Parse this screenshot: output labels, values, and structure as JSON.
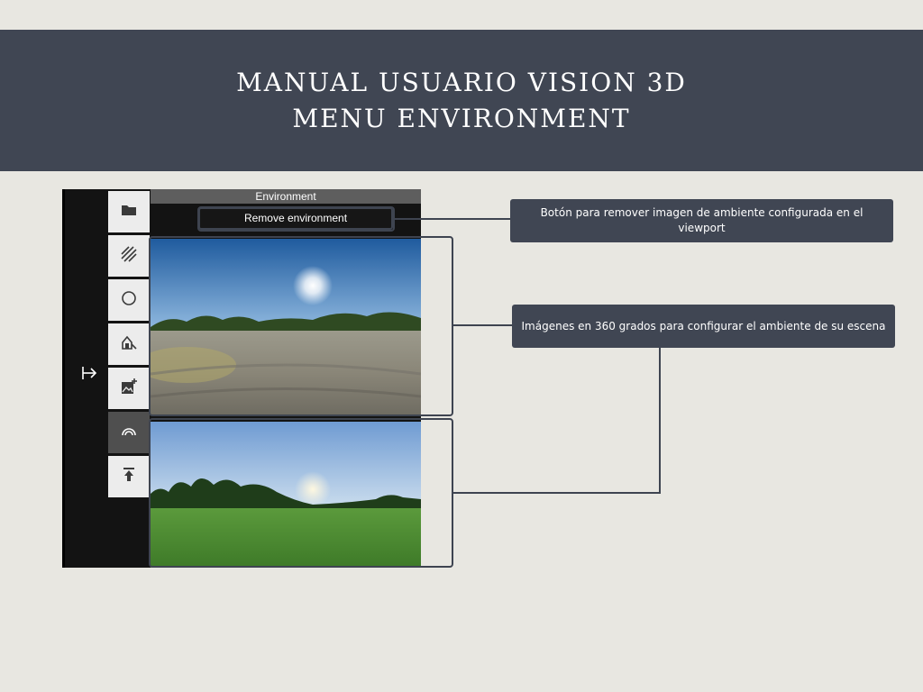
{
  "header": {
    "title_line1": "MANUAL USUARIO VISION 3D",
    "title_line2": "MENU ENVIRONMENT"
  },
  "app": {
    "panel_title": "Environment",
    "remove_button_label": "Remove environment",
    "toolbar": [
      {
        "icon": "folder-icon",
        "active": false
      },
      {
        "icon": "hatch-pattern-icon",
        "active": false
      },
      {
        "icon": "circle-icon",
        "active": false
      },
      {
        "icon": "house-light-icon",
        "active": false
      },
      {
        "icon": "add-image-icon",
        "active": false
      },
      {
        "icon": "environment-dome-icon",
        "active": true
      },
      {
        "icon": "upload-icon",
        "active": false
      }
    ],
    "collapse_icon": "arrow-right-bar-icon",
    "environments": [
      {
        "name": "gravel-field-sunny",
        "sky": "#2f6fb3",
        "ground": "#8a877d"
      },
      {
        "name": "green-meadow-forest",
        "sky": "#7aa3d6",
        "ground": "#4f8a34"
      }
    ]
  },
  "callouts": {
    "remove": "Botón para remover imagen de ambiente configurada en el viewport",
    "images": "Imágenes en 360 grados para configurar el ambiente de su escena"
  },
  "colors": {
    "background": "#e8e7e1",
    "header": "#404653",
    "callout": "#404653"
  }
}
